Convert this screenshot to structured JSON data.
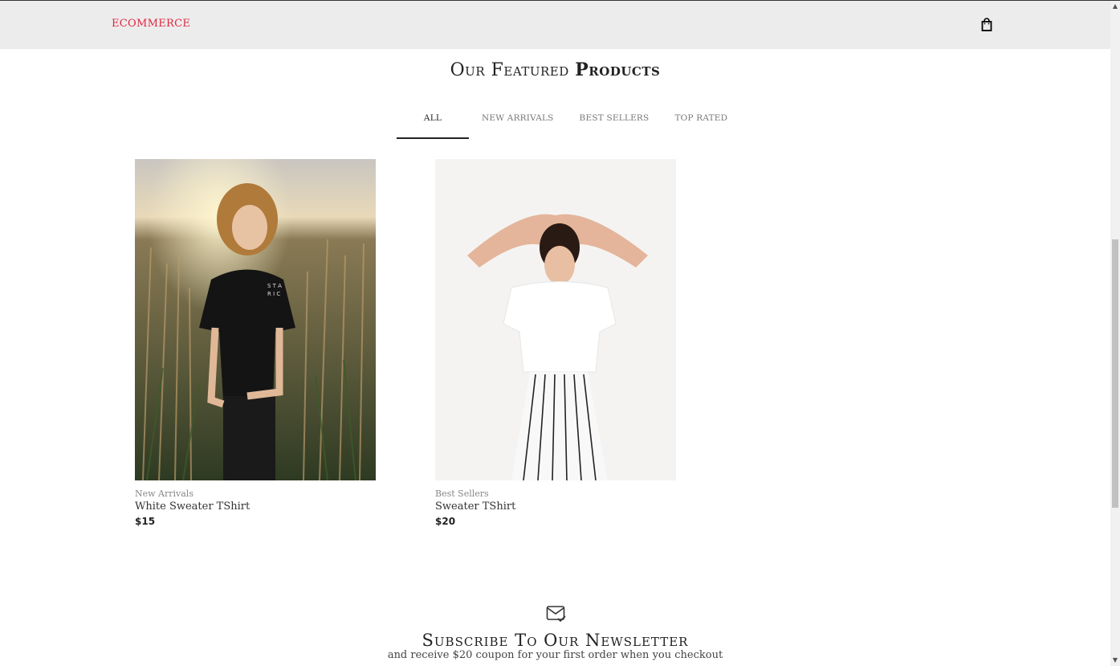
{
  "brand": {
    "name": "ECOMMERCE",
    "color": "#e0263f"
  },
  "header": {
    "cart_icon": "shopping-bag-icon"
  },
  "featured": {
    "title_light": "Our Featured",
    "title_bold": "Products",
    "tabs": [
      {
        "label": "ALL",
        "active": true
      },
      {
        "label": "NEW ARRIVALS",
        "active": false
      },
      {
        "label": "BEST SELLERS",
        "active": false
      },
      {
        "label": "TOP RATED",
        "active": false
      }
    ]
  },
  "products": [
    {
      "category": "New Arrivals",
      "name": "White Sweater TShirt",
      "price": "$15"
    },
    {
      "category": "Best Sellers",
      "name": "Sweater TShirt",
      "price": "$20"
    }
  ],
  "newsletter": {
    "icon": "mail-check-icon",
    "title": "Subscribe To Our Newsletter",
    "subtitle": "and receive $20 coupon for your first order when you checkout"
  }
}
